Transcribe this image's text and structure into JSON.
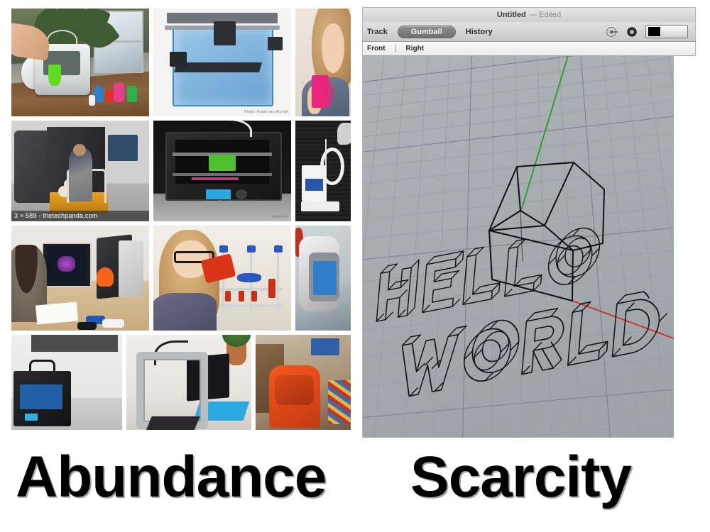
{
  "slide": {
    "left_caption": "Abundance",
    "right_caption": "Scarcity"
  },
  "collage": {
    "name": "3d-printer-image-search-results",
    "rows": [
      {
        "cells": [
          {
            "name": "photo-desk-3d-printer-with-prints",
            "alt": "Hand reaching into white desktop 3D printer on wooden desk beside plant and colourful printed objects",
            "caption": "",
            "watermark": ""
          },
          {
            "name": "photo-blue-transparent-printer",
            "alt": "Blue transparent acrylic 3D printer on white background",
            "caption": "",
            "watermark": "Photo: Frank van Klompf"
          },
          {
            "name": "photo-woman-with-pink-mug",
            "alt": "Smiling woman holding a pink 3D printed mug",
            "caption": "",
            "watermark": ""
          }
        ]
      },
      {
        "cells": [
          {
            "name": "photo-industrial-printer-worker",
            "alt": "Worker pulling cart of printed parts from large industrial 3D printer",
            "caption": "3 × 589 - thetechpanda.com",
            "watermark": ""
          },
          {
            "name": "photo-makerbot-replicator-2",
            "alt": "MakerBot Replicator 2 desktop 3D printer",
            "caption": "",
            "watermark": "MakerBot",
            "brand": "MakerBot Replicator 2"
          },
          {
            "name": "photo-white-printer-dark-room",
            "alt": "White 3D printer and printed ring on a dark background",
            "caption": "",
            "watermark": ""
          }
        ]
      },
      {
        "cells": [
          {
            "name": "photo-woman-3d-scanner-desk",
            "alt": "Woman at desk using 3D scanner with monitor and printed toy cars",
            "caption": "",
            "watermark": ""
          },
          {
            "name": "photo-woman-glasses-blue-printer",
            "alt": "Blonde woman with glasses inspecting a red 3D print beside a blue RepRap printer",
            "caption": "",
            "watermark": ""
          },
          {
            "name": "photo-cube-printer-closeup",
            "alt": "Close-up of rounded grey Cube 3D printer with blue print",
            "caption": "",
            "watermark": ""
          }
        ]
      },
      {
        "cells": [
          {
            "name": "photo-black-printer-room",
            "alt": "Black MakerBot Replicator 2 printer in a bright room",
            "caption": "",
            "watermark": ""
          },
          {
            "name": "photo-aluminium-cube-frame-tablet",
            "alt": "Aluminium cube printer frame on desk with tablet, blue keyboard and potted plant",
            "caption": "",
            "watermark": ""
          },
          {
            "name": "photo-orange-chair-objects",
            "alt": "Orange plastic chair and assorted objects by a wooden table",
            "caption": "",
            "watermark": ""
          }
        ]
      }
    ]
  },
  "cad_window": {
    "title": "Untitled",
    "title_suffix": "— Edited",
    "toolbar": {
      "track_label": "Track",
      "gumball_label": "Gumball",
      "history_label": "History",
      "icons": [
        "target-icon",
        "record-icon",
        "color-swatch"
      ],
      "swatch_color": "#000000"
    },
    "viewtabs": {
      "front_label": "Front",
      "right_label": "Right"
    },
    "viewport": {
      "name": "3d-viewport",
      "background_color": "#a7acb2",
      "grid_color": "#8b9097",
      "axis_x_color": "#cc3322",
      "axis_y_color": "#2f9e2f",
      "objects": [
        {
          "name": "wireframe-box",
          "type": "box"
        },
        {
          "name": "wireframe-text-hello",
          "type": "extruded-text",
          "text": "HELLO"
        },
        {
          "name": "wireframe-text-world",
          "type": "extruded-text",
          "text": "WORLD"
        }
      ]
    }
  }
}
